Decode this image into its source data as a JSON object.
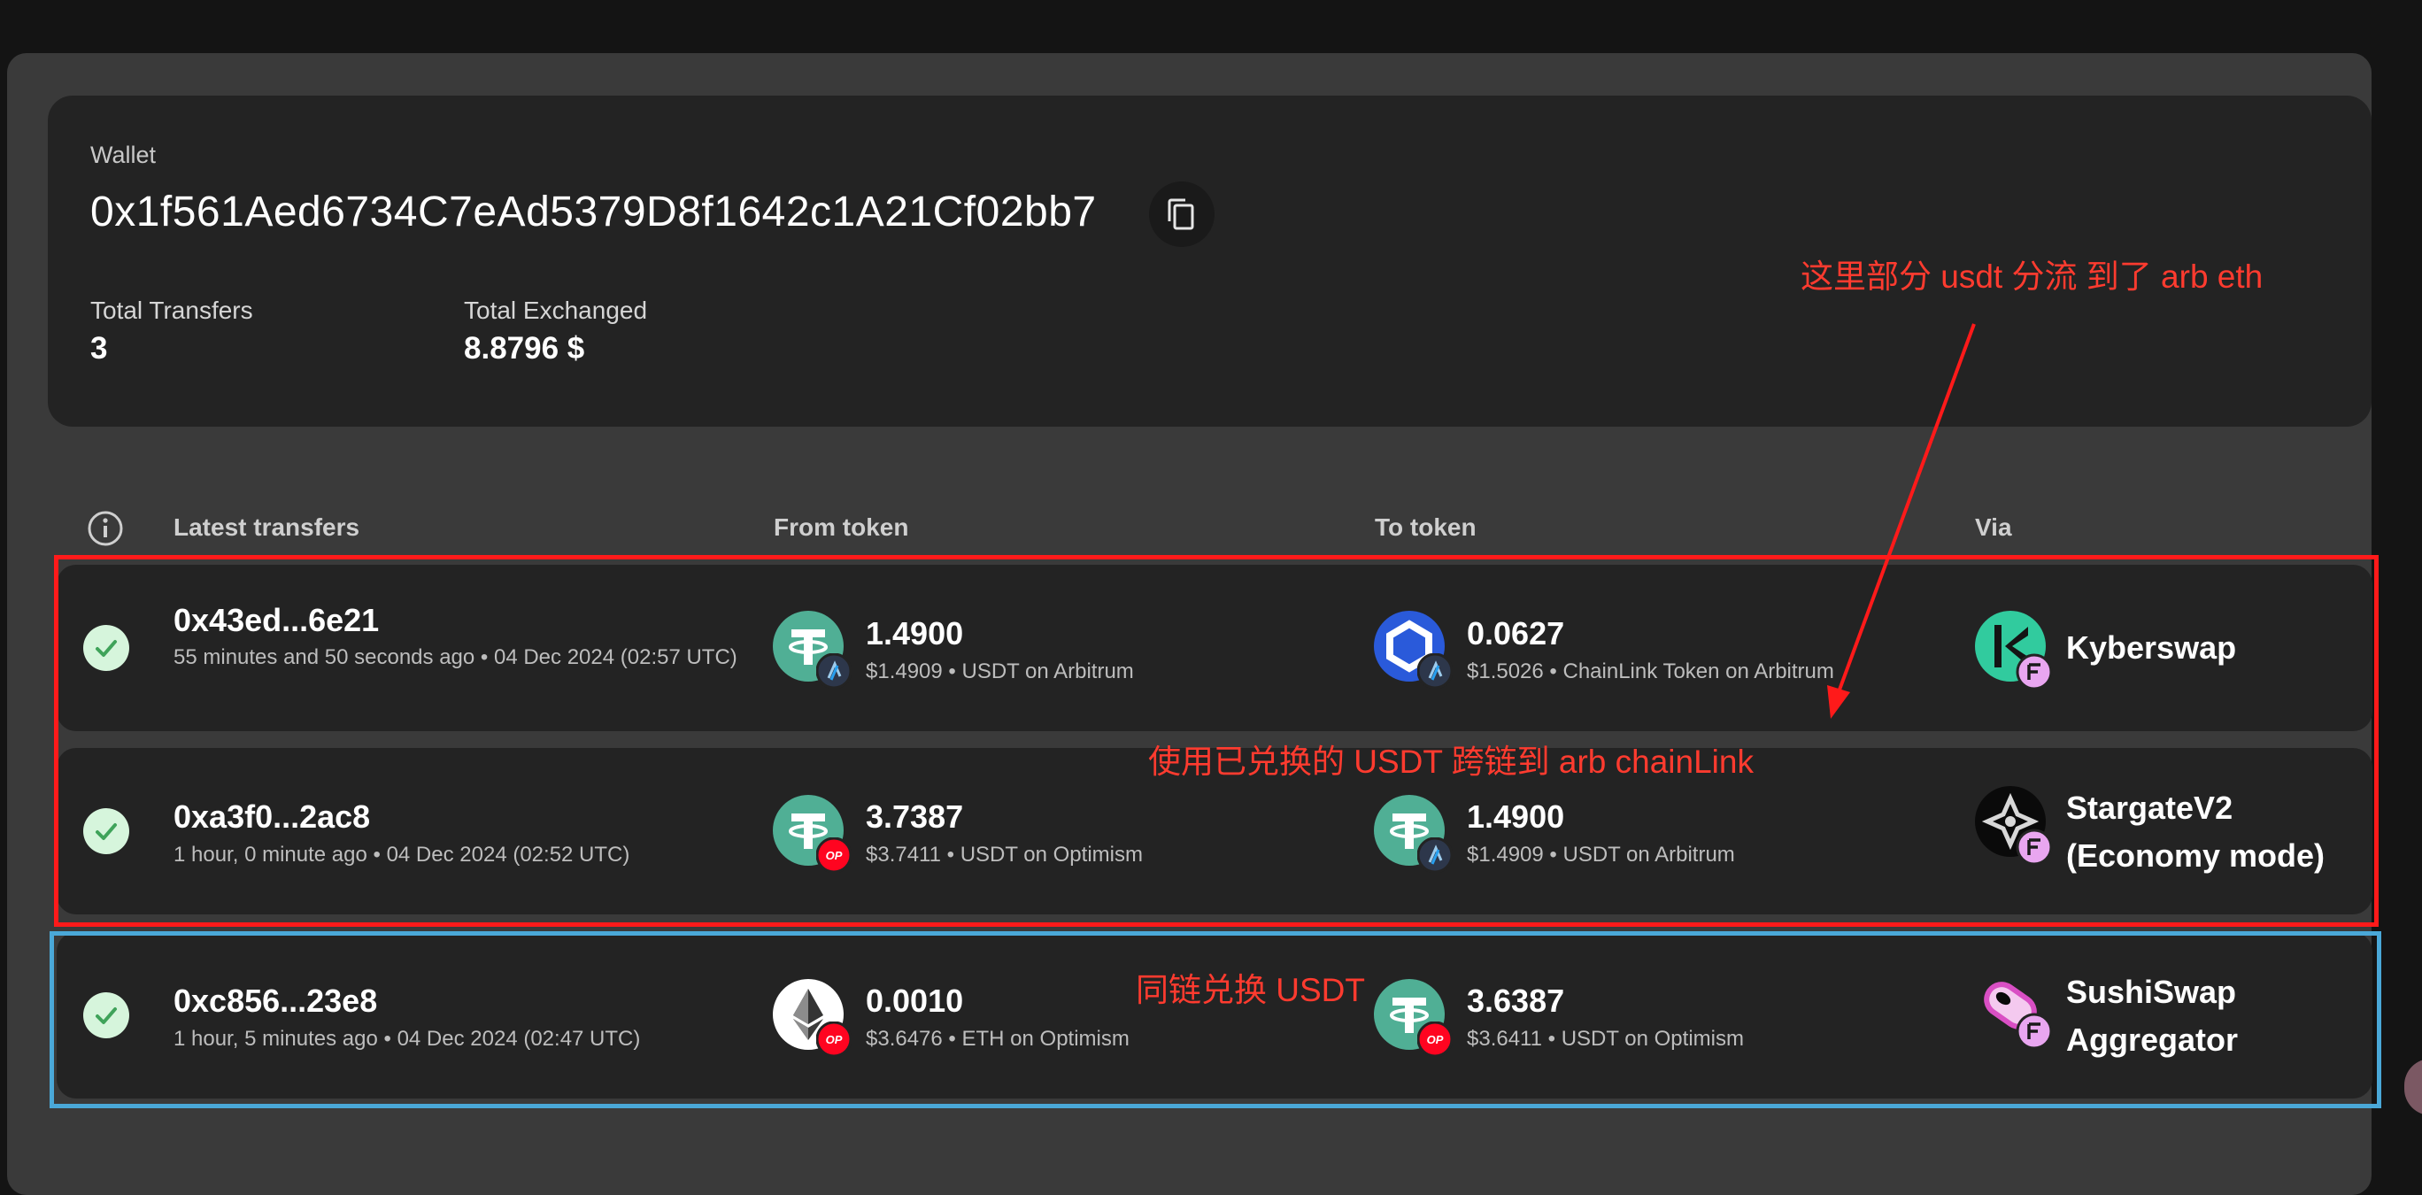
{
  "wallet": {
    "label": "Wallet",
    "address": "0x1f561Aed6734C7eAd5379D8f1642c1A21Cf02bb7",
    "stats": [
      {
        "label": "Total Transfers",
        "value": "3"
      },
      {
        "label": "Total Exchanged",
        "value": "8.8796 $"
      }
    ]
  },
  "table": {
    "headers": {
      "latest": "Latest transfers",
      "from": "From token",
      "to": "To token",
      "via": "Via"
    },
    "rows": [
      {
        "status": "success",
        "hash": "0x43ed...6e21",
        "time": "55 minutes and 50 seconds ago • 04 Dec 2024 (02:57 UTC)",
        "from": {
          "amount": "1.4900",
          "sub": "$1.4909 • USDT on Arbitrum",
          "token_icon": "tether-icon",
          "chain_icon": "arbitrum-icon"
        },
        "to": {
          "amount": "0.0627",
          "sub": "$1.5026 • ChainLink Token on Arbitrum",
          "token_icon": "chainlink-icon",
          "chain_icon": "arbitrum-icon"
        },
        "via": {
          "name_line1": "Kyberswap",
          "name_line2": "",
          "icon": "kyberswap-icon"
        }
      },
      {
        "status": "success",
        "hash": "0xa3f0...2ac8",
        "time": "1 hour, 0 minute ago • 04 Dec 2024 (02:52 UTC)",
        "from": {
          "amount": "3.7387",
          "sub": "$3.7411 • USDT on Optimism",
          "token_icon": "tether-icon",
          "chain_icon": "optimism-icon"
        },
        "to": {
          "amount": "1.4900",
          "sub": "$1.4909 • USDT on Arbitrum",
          "token_icon": "tether-icon",
          "chain_icon": "arbitrum-icon"
        },
        "via": {
          "name_line1": "StargateV2",
          "name_line2": "(Economy mode)",
          "icon": "stargate-icon"
        }
      },
      {
        "status": "success",
        "hash": "0xc856...23e8",
        "time": "1 hour, 5 minutes ago • 04 Dec 2024 (02:47 UTC)",
        "from": {
          "amount": "0.0010",
          "sub": "$3.6476 • ETH on Optimism",
          "token_icon": "ethereum-icon",
          "chain_icon": "optimism-icon"
        },
        "to": {
          "amount": "3.6387",
          "sub": "$3.6411 • USDT on Optimism",
          "token_icon": "tether-icon",
          "chain_icon": "optimism-icon"
        },
        "via": {
          "name_line1": "SushiSwap",
          "name_line2": "Aggregator",
          "icon": "sushiswap-icon"
        }
      }
    ]
  },
  "annotations": {
    "arb_eth": "这里部分 usdt 分流 到了 arb eth",
    "cross_chain": "使用已兑换的 USDT 跨链到 arb chainLink",
    "same_chain": "同链兑换 USDT"
  },
  "chain_badges": {
    "optimism": "OP"
  },
  "colors": {
    "panel": "#3a3a3a",
    "card": "#232323",
    "success": "#d6f5dc",
    "tether": "#50af95",
    "chainlink": "#2a5ada",
    "annotation_red": "#ff1a1a",
    "annotation_blue": "#4aa8d8"
  }
}
